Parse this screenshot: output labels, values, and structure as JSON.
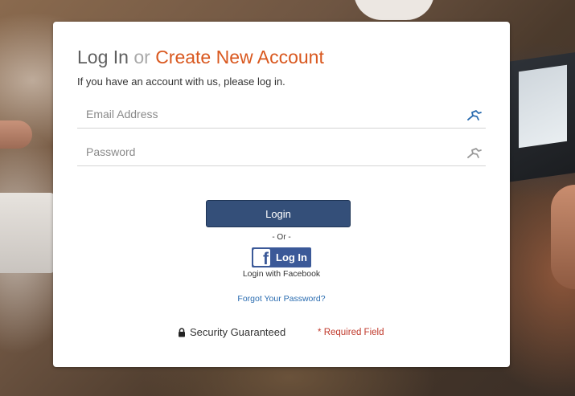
{
  "header": {
    "login_text": "Log In",
    "or_text": "or",
    "create_account_text": "Create New Account",
    "subtitle": "If you have an account with us, please log in."
  },
  "form": {
    "email": {
      "placeholder": "Email Address",
      "value": ""
    },
    "password": {
      "placeholder": "Password",
      "value": ""
    },
    "email_icon": "runner-icon",
    "password_icon": "runner-icon"
  },
  "actions": {
    "login_label": "Login",
    "or_separator": "- Or -",
    "facebook_button_label": "Log In",
    "facebook_logo_letter": "f",
    "facebook_caption": "Login with Facebook",
    "forgot_password": "Forgot Your Password?"
  },
  "footer": {
    "security_text": "Security Guaranteed",
    "required_marker": "*",
    "required_text": "Required Field"
  },
  "colors": {
    "accent_orange": "#d9581f",
    "login_button": "#344f79",
    "facebook_blue": "#3b5998",
    "link_blue": "#2a6cb0",
    "required_red": "#c0392b"
  }
}
